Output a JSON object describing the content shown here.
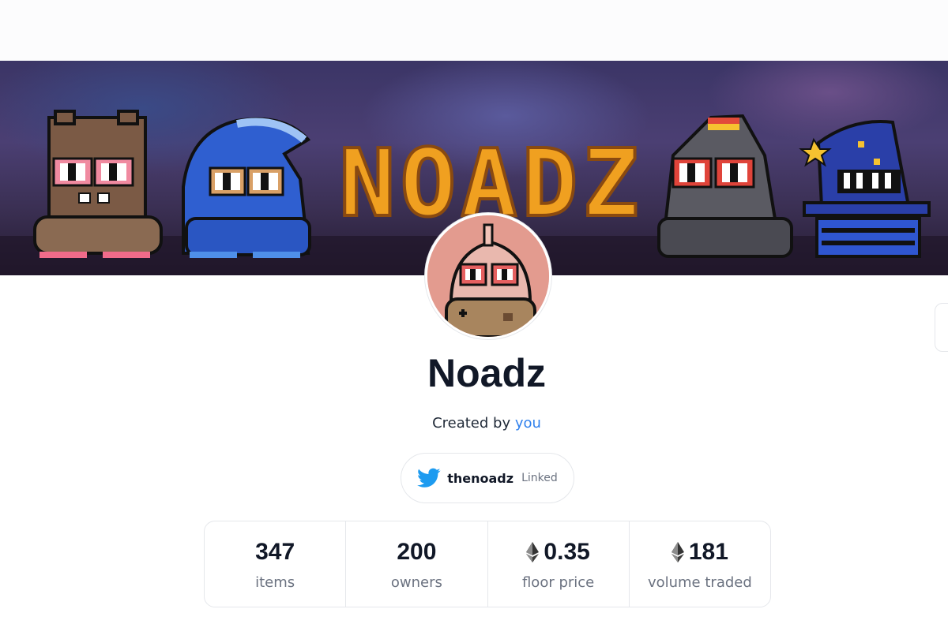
{
  "collection": {
    "title": "Noadz",
    "created_prefix": "Created by",
    "created_by": "you",
    "banner_text": "NOADZ"
  },
  "twitter": {
    "icon": "twitter-bird-icon",
    "handle": "thenoadz",
    "status": "Linked"
  },
  "stats": [
    {
      "value": "347",
      "label": "items",
      "icon": null
    },
    {
      "value": "200",
      "label": "owners",
      "icon": null
    },
    {
      "value": "0.35",
      "label": "floor price",
      "icon": "ethereum-icon"
    },
    {
      "value": "181",
      "label": "volume traded",
      "icon": "ethereum-icon"
    }
  ],
  "colors": {
    "link": "#2f80ed",
    "twitter": "#1d9bf0",
    "border": "#e5e7eb",
    "banner_title": "#f0a020"
  }
}
